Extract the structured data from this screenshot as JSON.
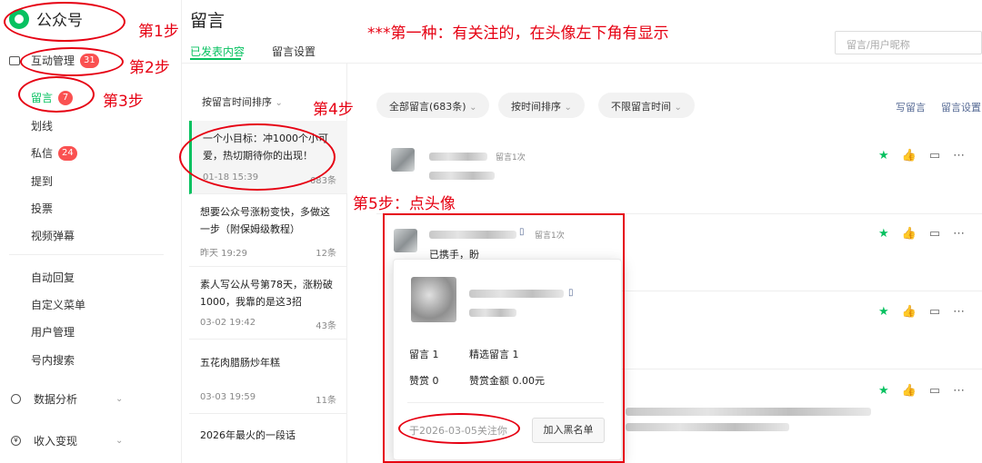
{
  "app": {
    "name": "公众号"
  },
  "sidebar": {
    "interaction": {
      "label": "互动管理",
      "badge": "31"
    },
    "items": [
      {
        "label": "留言",
        "badge": "7"
      },
      {
        "label": "划线"
      },
      {
        "label": "私信",
        "badge": "24"
      },
      {
        "label": "提到"
      },
      {
        "label": "投票"
      },
      {
        "label": "视频弹幕"
      },
      {
        "label": "自动回复"
      },
      {
        "label": "自定义菜单"
      },
      {
        "label": "用户管理"
      },
      {
        "label": "号内搜索"
      }
    ],
    "analytics": {
      "label": "数据分析"
    },
    "revenue": {
      "label": "收入变现"
    }
  },
  "header": {
    "title": "留言",
    "tabs": [
      {
        "label": "已发表内容"
      },
      {
        "label": "留言设置"
      }
    ],
    "search_placeholder": "留言/用户昵称"
  },
  "annotations": {
    "step1": "第1步",
    "step2": "第2步",
    "step3": "第3步",
    "step4": "第4步",
    "step5": "第5步：点头像",
    "note": "***第一种：有关注的，在头像左下角有显示"
  },
  "articles": {
    "sort_label": "按留言时间排序",
    "list": [
      {
        "title": "一个小目标：冲1000个小可爱，热切期待你的出现！",
        "date": "01-18 15:39",
        "count": "683条"
      },
      {
        "title": "想要公众号涨粉变快，多做这一步（附保姆级教程）",
        "date": "昨天 19:29",
        "count": "12条"
      },
      {
        "title": "素人写公从号第78天，涨粉破1000，我靠的是这3招",
        "date": "03-02 19:42",
        "count": "43条"
      },
      {
        "title": "五花肉腊肠炒年糕",
        "date": "03-03 19:59",
        "count": "11条"
      },
      {
        "title": "2026年最火的一段话",
        "date": "",
        "count": ""
      }
    ]
  },
  "filters": {
    "all": "全部留言(683条)",
    "time_sort": "按时间排序",
    "time_range": "不限留言时间",
    "write": "写留言",
    "settings": "留言设置"
  },
  "comments": [
    {
      "meta": "留言1次",
      "text": ""
    },
    {
      "meta": "留言1次",
      "text": "已携手，盼"
    }
  ],
  "popup": {
    "stats": [
      {
        "label": "留言",
        "value": "1"
      },
      {
        "label": "精选留言",
        "value": "1"
      },
      {
        "label": "赞赏",
        "value": "0"
      },
      {
        "label": "赞赏金额",
        "value": "0.00元"
      }
    ],
    "follow_text": "于2026-03-05关注你",
    "blacklist_button": "加入黑名单"
  },
  "colors": {
    "accent": "#07c160",
    "annotation_red": "#e60012",
    "badge_red": "#fa5151",
    "link": "#576b95"
  }
}
